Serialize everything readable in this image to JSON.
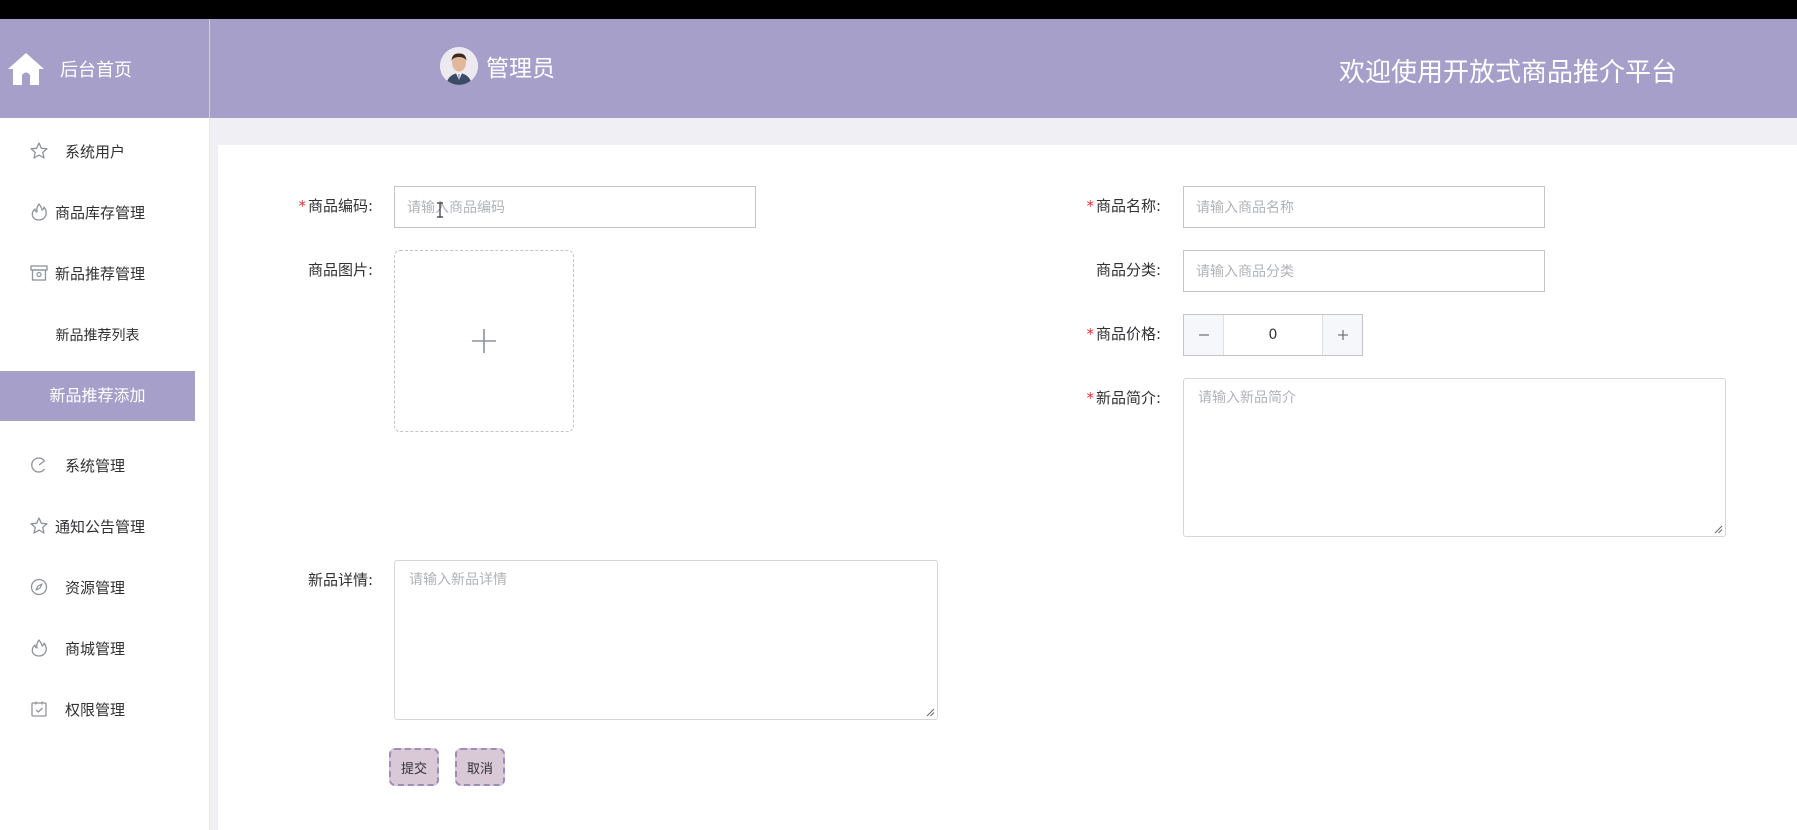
{
  "header": {
    "brand": "后台首页",
    "user_name": "管理员",
    "welcome": "欢迎使用开放式商品推介平台",
    "color": "#a69fc9"
  },
  "sidebar": {
    "items": [
      {
        "label": "系统用户",
        "icon": "star-icon"
      },
      {
        "label": "商品库存管理",
        "icon": "fire-icon"
      },
      {
        "label": "新品推荐管理",
        "icon": "box-icon"
      },
      {
        "label": "系统管理",
        "icon": "pie-icon"
      },
      {
        "label": "通知公告管理",
        "icon": "star-icon"
      },
      {
        "label": "资源管理",
        "icon": "compass-icon"
      },
      {
        "label": "商城管理",
        "icon": "fire-icon"
      },
      {
        "label": "权限管理",
        "icon": "calendar-check-icon"
      }
    ],
    "submenu": [
      "新品推荐列表",
      "新品推荐添加"
    ],
    "active_color": "#a69fc9"
  },
  "form": {
    "code": {
      "label": "商品编码:",
      "placeholder": "请输入商品编码"
    },
    "name": {
      "label": "商品名称:",
      "placeholder": "请输入商品名称"
    },
    "image": {
      "label": "商品图片:"
    },
    "category": {
      "label": "商品分类:",
      "placeholder": "请输入商品分类"
    },
    "price": {
      "label": "商品价格:",
      "value": "0"
    },
    "intro": {
      "label": "新品简介:",
      "placeholder": "请输入新品简介"
    },
    "detail": {
      "label": "新品详情:",
      "placeholder": "请输入新品详情"
    },
    "required_mark": "*",
    "submit": "提交",
    "cancel": "取消"
  }
}
